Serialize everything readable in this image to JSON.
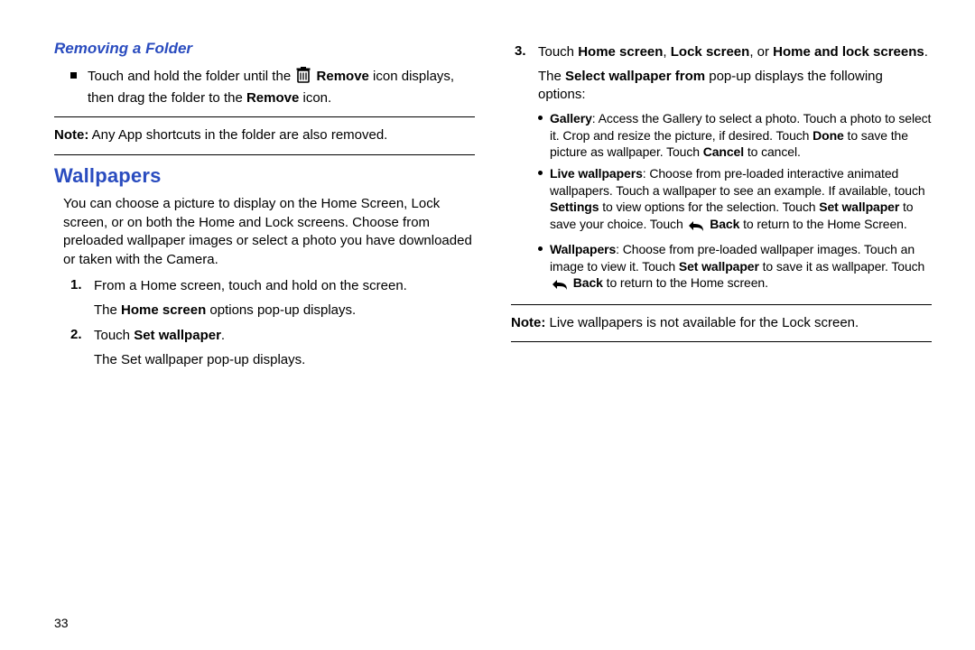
{
  "page_number": "33",
  "left": {
    "sub_heading": "Removing a Folder",
    "bullet_pre": "Touch and hold the folder until the ",
    "bullet_icon_label": "Remove",
    "bullet_mid": " icon displays, then drag the folder to the ",
    "bullet_bold2": "Remove",
    "bullet_post": " icon.",
    "note_label": "Note:",
    "note_text": " Any App shortcuts in the folder are also removed.",
    "sec_heading": "Wallpapers",
    "intro": "You can choose a picture to display on the Home Screen, Lock screen, or on both the Home and Lock screens. Choose from preloaded wallpaper images or select a photo you have downloaded or taken with the Camera.",
    "s1_num": "1.",
    "s1_text": "From a Home screen, touch and hold on the screen.",
    "s1_sub_pre": "The ",
    "s1_sub_bold": "Home screen",
    "s1_sub_post": " options pop-up displays.",
    "s2_num": "2.",
    "s2_pre": "Touch ",
    "s2_bold": "Set wallpaper",
    "s2_post": ".",
    "s2_sub": "The Set wallpaper pop-up displays."
  },
  "right": {
    "s3_num": "3.",
    "s3_pre": "Touch ",
    "s3_b1": "Home screen",
    "s3_m1": ", ",
    "s3_b2": "Lock screen",
    "s3_m2": ", or ",
    "s3_b3": "Home and lock screens",
    "s3_post": ".",
    "s3_sub_pre": "The ",
    "s3_sub_bold": "Select wallpaper from",
    "s3_sub_post": " pop-up displays the following options:",
    "opt1_b": "Gallery",
    "opt1_t1": ": Access the Gallery to select a photo. Touch a photo to select it. Crop and resize the picture, if desired. Touch ",
    "opt1_b2": "Done",
    "opt1_t2": " to save the picture as wallpaper. Touch ",
    "opt1_b3": "Cancel",
    "opt1_t3": " to cancel.",
    "opt2_b": "Live wallpapers",
    "opt2_t1": ": Choose from pre-loaded interactive animated wallpapers. Touch a wallpaper to see an example. If available, touch ",
    "opt2_b2": "Settings",
    "opt2_t2": " to view options for the selection. Touch ",
    "opt2_b3": "Set wallpaper",
    "opt2_t3": " to save your choice. Touch ",
    "opt2_back": "Back",
    "opt2_t4": " to return to the Home Screen.",
    "opt3_b": "Wallpapers",
    "opt3_t1": ": Choose from pre-loaded wallpaper images. Touch an image to view it. Touch ",
    "opt3_b2": "Set wallpaper",
    "opt3_t2": " to save it as wallpaper. Touch ",
    "opt3_back": "Back",
    "opt3_t3": " to return to the Home screen.",
    "note_label": "Note:",
    "note_text": " Live wallpapers is not available for the Lock screen."
  }
}
